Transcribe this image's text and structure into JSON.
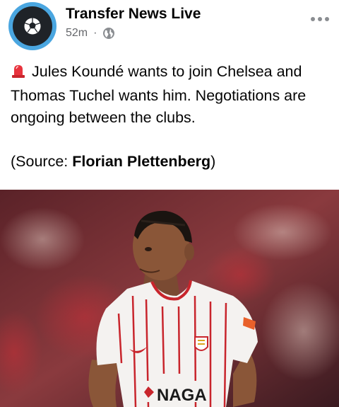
{
  "post": {
    "page_name": "Transfer News Live",
    "time": "52m",
    "separator": "·",
    "audience_icon": "globe-icon",
    "more_icon": "more-horizontal-icon",
    "avatar_icon": "soccer-ball-icon",
    "lead_icon": "police-siren-emoji",
    "text_line1": "Jules Koundé wants to join Chelsea and Thomas Tuchel wants him. Negotiations are ongoing between the clubs.",
    "source_prefix": "(Source: ",
    "source_name": "Florian Plettenberg",
    "source_suffix": ")"
  },
  "image": {
    "subject": "football-player-photo",
    "sponsor_text": "NAGA",
    "colors": {
      "jersey": "#f4f2f0",
      "stripe": "#c8252c",
      "background": "#7a2a2f"
    }
  }
}
